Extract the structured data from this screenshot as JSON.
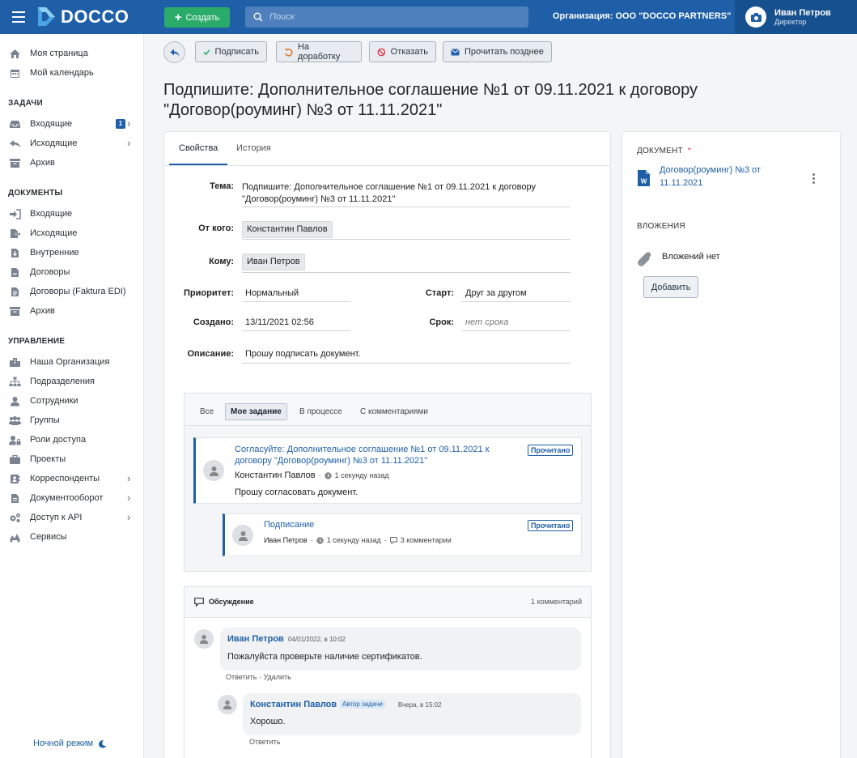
{
  "app": {
    "brand": "DOCCO",
    "create_label": "Создать",
    "search_placeholder": "Поиск",
    "org_label": "Организация: ООО \"DOCCO PARTNERS\"",
    "user_name": "Иван Петров",
    "user_role": "Директор"
  },
  "sidebar": {
    "top_items": [
      "Моя страница",
      "Мой календарь"
    ],
    "section_tasks": "ЗАДАЧИ",
    "tasks_items": [
      "Входящие",
      "Исходящие",
      "Архив"
    ],
    "tasks_badge": "1",
    "section_docs": "ДОКУМЕНТЫ",
    "docs_items": [
      "Входящие",
      "Исходящие",
      "Внутренние",
      "Договоры",
      "Договоры (Faktura EDI)",
      "Архив"
    ],
    "section_mgmt": "УПРАВЛЕНИЕ",
    "mgmt_items": [
      "Наша Организация",
      "Подразделения",
      "Сотрудники",
      "Группы",
      "Роли доступа",
      "Проекты",
      "Корреспонденты",
      "Документооборот",
      "Доступ к API",
      "Сервисы"
    ],
    "night_mode": "Ночной режим"
  },
  "toolbar": {
    "sign": "Подписать",
    "rework": "На доработку",
    "decline": "Отказать",
    "read_later": "Прочитать позднее"
  },
  "page_title": "Подпишите: Дополнительное соглашение №1 от 09.11.2021 к договору \"Договор(роуминг) №3 от 11.11.2021\"",
  "tabs": [
    "Свойства",
    "История"
  ],
  "props": {
    "topic_label": "Тема:",
    "topic_line1": "Подпишите: Дополнительное соглашение №1 от 09.11.2021 к договору",
    "topic_line2": "\"Договор(роуминг) №3 от 11.11.2021\"",
    "from_label": "От кого:",
    "from_value": "Константин Павлов",
    "to_label": "Кому:",
    "to_value": "Иван Петров",
    "priority_label": "Приоритет:",
    "priority_value": "Нормальный",
    "start_label": "Старт:",
    "start_value": "Друг за другом",
    "created_label": "Создано:",
    "created_value": "13/11/2021 02:56",
    "due_label": "Срок:",
    "due_value": "нет срока",
    "desc_label": "Описание:",
    "desc_value": "Прошу подписать документ."
  },
  "task_filters": [
    "Все",
    "Мое задание",
    "В процессе",
    "С комментариями"
  ],
  "tasks": [
    {
      "title_line1": "Согласуйте: Дополнительное соглашение №1 от 09.11.2021 к",
      "title_line2": "договору \"Договор(роуминг) №3 от 11.11.2021\"",
      "author": "Константин Павлов",
      "time": "1 секунду назад",
      "status": "Прочитано",
      "text": "Прошу согласовать документ."
    },
    {
      "title": "Подписание",
      "author": "Иван Петров",
      "time": "1 секунду назад",
      "comments": "3 комментарии",
      "status": "Прочитано"
    }
  ],
  "discussion": {
    "title": "Обсуждение",
    "count": "1 комментарий",
    "comments": [
      {
        "author": "Иван Петров",
        "date": "04/01/2022, в 10:02",
        "text": "Пожалуйста проверьте наличие сертификатов.",
        "actions": "Ответить · Удалить"
      },
      {
        "author": "Константин Павлов",
        "role_badge": "Автор задачи",
        "date": "Вчера, в 15:02",
        "text": "Хорошо.",
        "actions": "Ответить"
      }
    ]
  },
  "side": {
    "doc_label": "ДОКУМЕНТ",
    "doc_required": "*",
    "doc_link_line1": "Договор(роуминг) №3 от",
    "doc_link_line2": "11.11.2021",
    "attach_label": "ВЛОЖЕНИЯ",
    "no_attach": "Вложений нет",
    "add_button": "Добавить"
  },
  "colors": {
    "brand": "#1e5fa8",
    "create": "#2bab6a",
    "required": "#d9344b"
  }
}
